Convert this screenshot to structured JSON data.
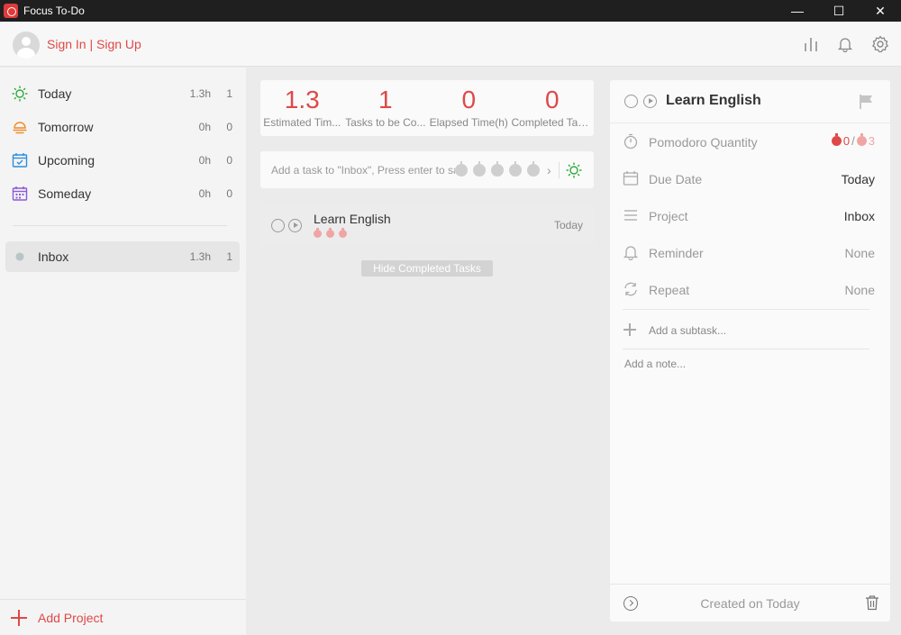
{
  "app": {
    "title": "Focus To-Do",
    "window_buttons": {
      "minimize": "—",
      "maximize": "☐",
      "close": "✕"
    }
  },
  "header": {
    "signin": "Sign In | Sign Up",
    "icons": [
      "stats-icon",
      "bell-icon",
      "gear-icon"
    ]
  },
  "sidebar": {
    "items": [
      {
        "label": "Today",
        "duration": "1.3h",
        "count": "1",
        "icon": "sun-icon",
        "color": "#2eaa3a"
      },
      {
        "label": "Tomorrow",
        "duration": "0h",
        "count": "0",
        "icon": "sunset-icon",
        "color": "#f08a24"
      },
      {
        "label": "Upcoming",
        "duration": "0h",
        "count": "0",
        "icon": "calendar-check-icon",
        "color": "#2b8fe0"
      },
      {
        "label": "Someday",
        "duration": "0h",
        "count": "0",
        "icon": "calendar-icon",
        "color": "#8a5ad6"
      }
    ],
    "projects": [
      {
        "label": "Inbox",
        "duration": "1.3h",
        "count": "1",
        "icon": "dot-icon",
        "color": "#b8c4c6"
      }
    ],
    "add_project": "Add Project"
  },
  "stats": [
    {
      "value": "1.3",
      "label": "Estimated Tim..."
    },
    {
      "value": "1",
      "label": "Tasks to be Co..."
    },
    {
      "value": "0",
      "label": "Elapsed Time(h)"
    },
    {
      "value": "0",
      "label": "Completed Tasks"
    }
  ],
  "add_task": {
    "placeholder": "Add a task to \"Inbox\", Press enter to sa"
  },
  "tasks": [
    {
      "title": "Learn English",
      "date": "Today",
      "pomodoros": 3
    }
  ],
  "hide_completed": "Hide Completed Tasks",
  "detail": {
    "title": "Learn English",
    "pomodoro": {
      "label": "Pomodoro Quantity",
      "done": "0",
      "sep": "/",
      "total": "3"
    },
    "due_date": {
      "label": "Due Date",
      "value": "Today"
    },
    "project": {
      "label": "Project",
      "value": "Inbox"
    },
    "reminder": {
      "label": "Reminder",
      "value": "None"
    },
    "repeat": {
      "label": "Repeat",
      "value": "None"
    },
    "add_subtask": "Add a subtask...",
    "add_note": "Add a note...",
    "created": "Created on Today"
  },
  "colors": {
    "accent": "#e04848",
    "titlebar": "#1f1f1f"
  }
}
